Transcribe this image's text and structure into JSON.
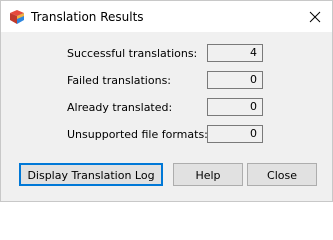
{
  "window": {
    "title": "Translation Results",
    "icon": "app-cube-icon",
    "close_icon": "close-icon"
  },
  "results": [
    {
      "label": "Successful translations:",
      "value": "4"
    },
    {
      "label": "Failed translations:",
      "value": "0"
    },
    {
      "label": "Already translated:",
      "value": "0"
    },
    {
      "label": "Unsupported file formats:",
      "value": "0"
    }
  ],
  "buttons": {
    "log": "Display Translation Log",
    "help": "Help",
    "close": "Close"
  },
  "colors": {
    "dialog_bg": "#f0f0f0",
    "titlebar_bg": "#ffffff",
    "default_button_border": "#0078d7"
  }
}
